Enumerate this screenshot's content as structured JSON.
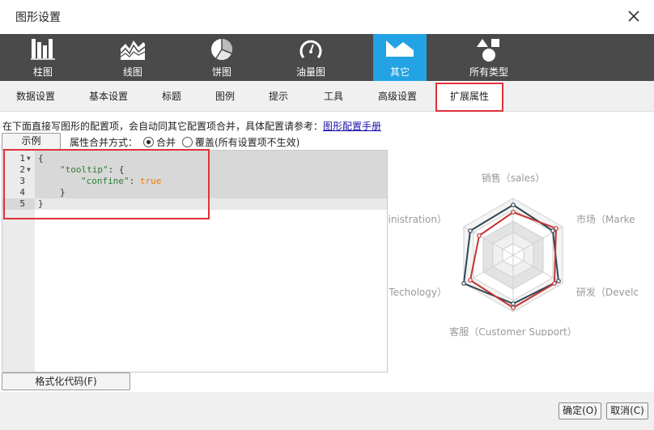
{
  "window": {
    "title": "图形设置"
  },
  "chart_types": [
    {
      "label": "柱图",
      "icon": "bar-chart-icon",
      "active": false
    },
    {
      "label": "线图",
      "icon": "line-chart-icon",
      "active": false
    },
    {
      "label": "饼图",
      "icon": "pie-chart-icon",
      "active": false
    },
    {
      "label": "油量图",
      "icon": "gauge-icon",
      "active": false
    },
    {
      "label": "其它",
      "icon": "other-chart-icon",
      "active": true
    },
    {
      "label": "所有类型",
      "icon": "all-types-icon",
      "active": false
    }
  ],
  "subtabs": [
    {
      "label": "数据设置",
      "active": false
    },
    {
      "label": "基本设置",
      "active": false
    },
    {
      "label": "标题",
      "active": false
    },
    {
      "label": "图例",
      "active": false
    },
    {
      "label": "提示",
      "active": false
    },
    {
      "label": "工具",
      "active": false
    },
    {
      "label": "高级设置",
      "active": false
    },
    {
      "label": "扩展属性",
      "active": true
    }
  ],
  "hint": {
    "text": "在下面直接写图形的配置项，会自动同其它配置项合并，具体配置请参考：",
    "link": "图形配置手册"
  },
  "controls": {
    "example_button": "示例",
    "merge_label": "属性合并方式：",
    "merge_option": "合并",
    "override_option": "覆盖(所有设置项不生效)",
    "selected": "merge",
    "format_button": "格式化代码(F)"
  },
  "editor": {
    "lines": [
      {
        "num": "1",
        "fold": true
      },
      {
        "num": "2",
        "fold": true
      },
      {
        "num": "3",
        "fold": false
      },
      {
        "num": "4",
        "fold": false
      },
      {
        "num": "5",
        "fold": false
      }
    ],
    "code": {
      "l1": "{",
      "l2_key": "\"tooltip\"",
      "l2_rest": ": {",
      "l3_key": "\"confine\"",
      "l3_colon": ": ",
      "l3_value": "true",
      "l4": "}",
      "l5": "}"
    }
  },
  "preview": {
    "labels": {
      "top": "销售（sales）",
      "upper_right": "市场（Marke",
      "lower_right": "研发（Develc",
      "bottom": "客服（Customer Support）",
      "lower_left": "Techology）",
      "upper_left": "ninistration）"
    },
    "colors": {
      "series1": "#2f4554",
      "series2": "#c23531"
    }
  },
  "footer": {
    "ok_button": "确定(O)",
    "cancel_button": "取消(C)"
  }
}
